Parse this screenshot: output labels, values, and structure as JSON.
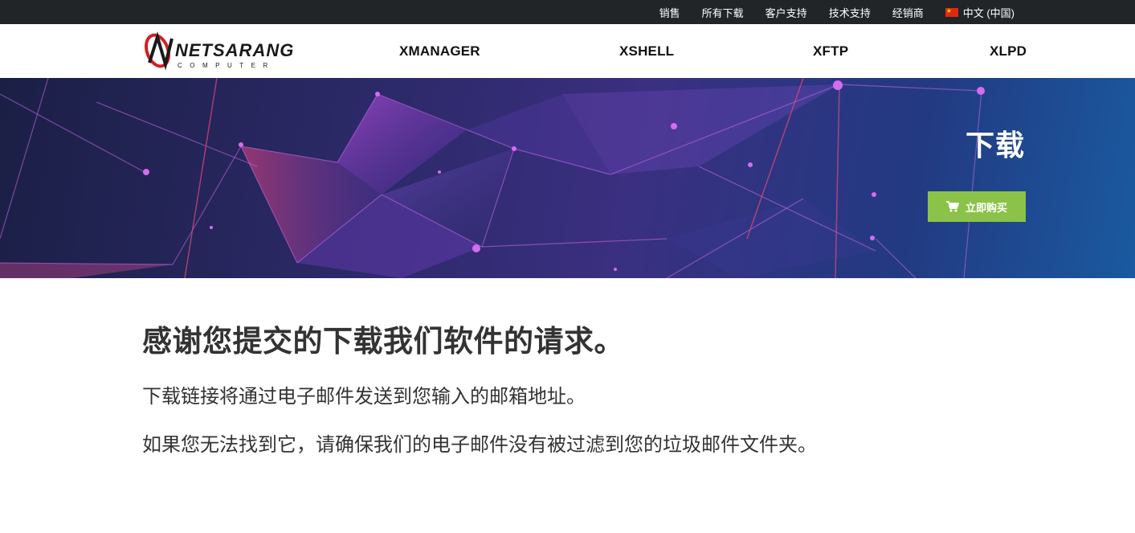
{
  "topbar": {
    "links": [
      "销售",
      "所有下载",
      "客户支持",
      "技术支持",
      "经销商"
    ],
    "language": "中文 (中国)"
  },
  "logo": {
    "text": "NETSARANG",
    "subtext": "COMPUTER",
    "brand_color": "#d31f26"
  },
  "nav": {
    "items": [
      "XMANAGER",
      "XSHELL",
      "XFTP",
      "XLPD"
    ]
  },
  "hero": {
    "title": "下载",
    "buy_button": "立即购买",
    "button_color": "#8bc34a"
  },
  "content": {
    "heading": "感谢您提交的下载我们软件的请求。",
    "paragraph1": "下载链接将通过电子邮件发送到您输入的邮箱地址。",
    "paragraph2": "如果您无法找到它，请确保我们的电子邮件没有被过滤到您的垃圾邮件文件夹。"
  }
}
